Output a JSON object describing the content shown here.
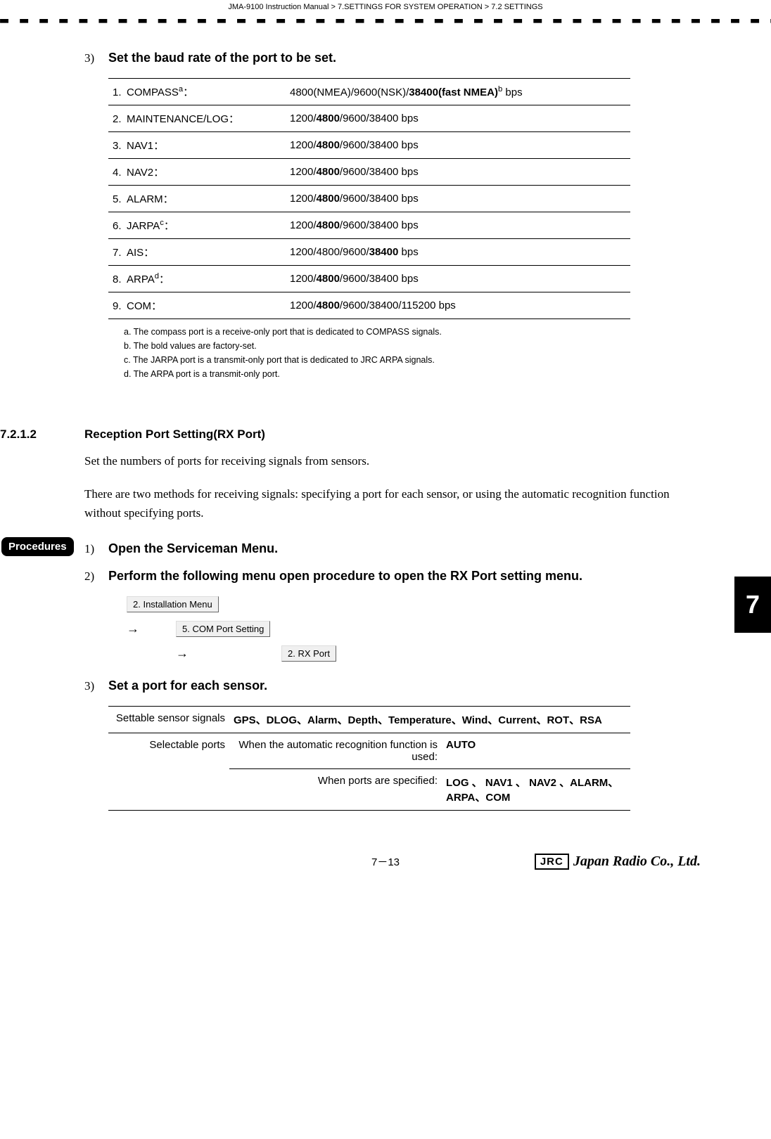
{
  "header": {
    "breadcrumb": "JMA-9100 Instruction Manual > 7.SETTINGS FOR SYSTEM OPERATION > 7.2  SETTINGS"
  },
  "step3": {
    "num": "3)",
    "title": "Set the baud rate of the port to be set."
  },
  "baud_table": [
    {
      "n": "1.",
      "label_html": "COMPASS<sup>a</sup>：",
      "value_html": "4800(NMEA)/9600(NSK)/<b>38400(fast NMEA)</b><sup>b</sup> bps"
    },
    {
      "n": "2.",
      "label_html": "MAINTENANCE/LOG：",
      "value_html": "1200/<b>4800</b>/9600/38400 bps"
    },
    {
      "n": "3.",
      "label_html": "NAV1：",
      "value_html": "1200/<b>4800</b>/9600/38400 bps"
    },
    {
      "n": "4.",
      "label_html": "NAV2：",
      "value_html": "1200/<b>4800</b>/9600/38400 bps"
    },
    {
      "n": "5.",
      "label_html": "ALARM：",
      "value_html": "1200/<b>4800</b>/9600/38400 bps"
    },
    {
      "n": "6.",
      "label_html": "JARPA<sup>c</sup>：",
      "value_html": "1200/<b>4800</b>/9600/38400 bps"
    },
    {
      "n": "7.",
      "label_html": "AIS：",
      "value_html": "1200/4800/9600/<b>38400</b> bps"
    },
    {
      "n": "8.",
      "label_html": "ARPA<sup>d</sup>：",
      "value_html": "1200/<b>4800</b>/9600/38400 bps"
    },
    {
      "n": "9.",
      "label_html": "COM：",
      "value_html": "1200/<b>4800</b>/9600/38400/115200 bps"
    }
  ],
  "notes": {
    "a": "a.  The compass port is a receive-only port that is dedicated to COMPASS signals.",
    "b": "b.  The bold values are factory-set.",
    "c": "c.  The JARPA port is a transmit-only port that is dedicated to JRC ARPA signals.",
    "d": "d.  The ARPA port is a transmit-only port."
  },
  "section": {
    "number": "7.2.1.2",
    "title": "Reception Port Setting(RX Port)",
    "p1": "Set the numbers of ports for receiving signals from sensors.",
    "p2": "There are two methods for receiving signals: specifying a port for each sensor, or using the automatic recognition function without specifying ports."
  },
  "procedures_label": "Procedures",
  "proc1": {
    "num": "1)",
    "title": "Open the Serviceman Menu."
  },
  "proc2": {
    "num": "2)",
    "title": "Perform the following menu open procedure to open the RX Port setting menu."
  },
  "menu_path": {
    "step1": "2. Installation Menu",
    "step2": "5. COM Port Setting",
    "step3": "2. RX Port",
    "arrow": "→"
  },
  "proc3": {
    "num": "3)",
    "title": "Set a port for each sensor."
  },
  "sensor_table": {
    "row1_label": "Settable sensor signals",
    "row1_value_html": "<b>GPS、DLOG、Alarm、Depth、Temperature、Wind、Current、ROT、RSA</b>",
    "row2_label": "Selectable ports",
    "row2a_left": "When the automatic recognition function is used:",
    "row2a_right_html": "<b>AUTO</b>",
    "row2b_left": "When ports are specified:",
    "row2b_right_html": "<b>LOG 、 NAV1 、 NAV2 、ALARM、ARPA、COM</b>"
  },
  "chapter_tab": "7",
  "footer": {
    "page": "7－13",
    "jrc": "JRC",
    "brand": "Japan Radio Co., Ltd."
  }
}
